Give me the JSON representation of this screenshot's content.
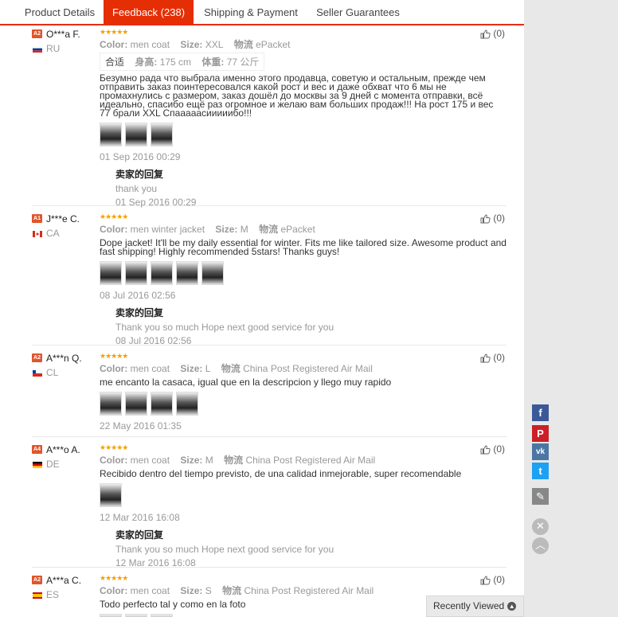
{
  "tabs": [
    {
      "label": "Product Details"
    },
    {
      "label": "Feedback (238)"
    },
    {
      "label": "Shipping & Payment"
    },
    {
      "label": "Seller Guarantees"
    }
  ],
  "labels": {
    "color": "Color:",
    "size": "Size:",
    "logistics": "物流",
    "reply_title": "卖家的回复",
    "height_key": "身高:",
    "weight_key": "体重:",
    "fit_key": "合适"
  },
  "reviews": [
    {
      "level": "A2",
      "name": "O***a F.",
      "country": "RU",
      "color": "men coat",
      "size": "XXL",
      "shipping": "ePacket",
      "height": "175 cm",
      "weight": "77 公斤",
      "text": "Безумно рада что выбрала именно этого продавца, советую и остальным, прежде чем отправить заказ поинтересовался какой рост и вес и даже обхват что 6 мы не промахнулись с размером, заказ дошёл до москвы за 9 дней с момента отправки, всё идеально, спасибо ещё раз огромное и желаю вам больших продаж!!! На рост 175 и вес 77 брали XXL Спааааасииииибо!!!",
      "photo_count": 3,
      "date": "01 Sep 2016 00:29",
      "reply": "thank you",
      "reply_date": "01 Sep 2016 00:29",
      "helpful": "(0)"
    },
    {
      "level": "A1",
      "name": "J***e C.",
      "country": "CA",
      "color": "men winter jacket",
      "size": "M",
      "shipping": "ePacket",
      "text": "Dope jacket! It'll be my daily essential for winter. Fits me like tailored size. Awesome product and fast shipping! Highly recommended 5stars! Thanks guys!",
      "photo_count": 5,
      "date": "08 Jul 2016 02:56",
      "reply": "Thank you so much Hope next good service for you",
      "reply_date": "08 Jul 2016 02:56",
      "helpful": "(0)"
    },
    {
      "level": "A2",
      "name": "A***n Q.",
      "country": "CL",
      "color": "men coat",
      "size": "L",
      "shipping": "China Post Registered Air Mail",
      "text": "me encanto la casaca, igual que en la descripcion y llego muy rapido",
      "photo_count": 4,
      "date": "22 May 2016 01:35",
      "helpful": "(0)"
    },
    {
      "level": "A4",
      "name": "A***o A.",
      "country": "DE",
      "color": "men coat",
      "size": "M",
      "shipping": "China Post Registered Air Mail",
      "text": "Recibido dentro del tiempo previsto, de una calidad inmejorable, super recomendable",
      "photo_count": 1,
      "date": "12 Mar 2016 16:08",
      "reply": "Thank you so much Hope next good service for you",
      "reply_date": "12 Mar 2016 16:08",
      "helpful": "(0)"
    },
    {
      "level": "A2",
      "name": "A***a C.",
      "country": "ES",
      "color": "men coat",
      "size": "S",
      "shipping": "China Post Registered Air Mail",
      "text": "Todo perfecto tal y como en la foto",
      "photo_count": 3,
      "helpful": "(0)"
    }
  ],
  "share": [
    {
      "icon": "facebook-icon",
      "glyph": "f",
      "color": "#3b5998"
    },
    {
      "icon": "pinterest-icon",
      "glyph": "P",
      "color": "#cb2027"
    },
    {
      "icon": "vk-icon",
      "glyph": "vk",
      "color": "#4c75a3"
    },
    {
      "icon": "twitter-icon",
      "glyph": "t",
      "color": "#1da1f2"
    },
    {
      "icon": "pencil-icon",
      "glyph": "✎",
      "color": "#888888"
    }
  ],
  "recently_viewed": "Recently Viewed"
}
